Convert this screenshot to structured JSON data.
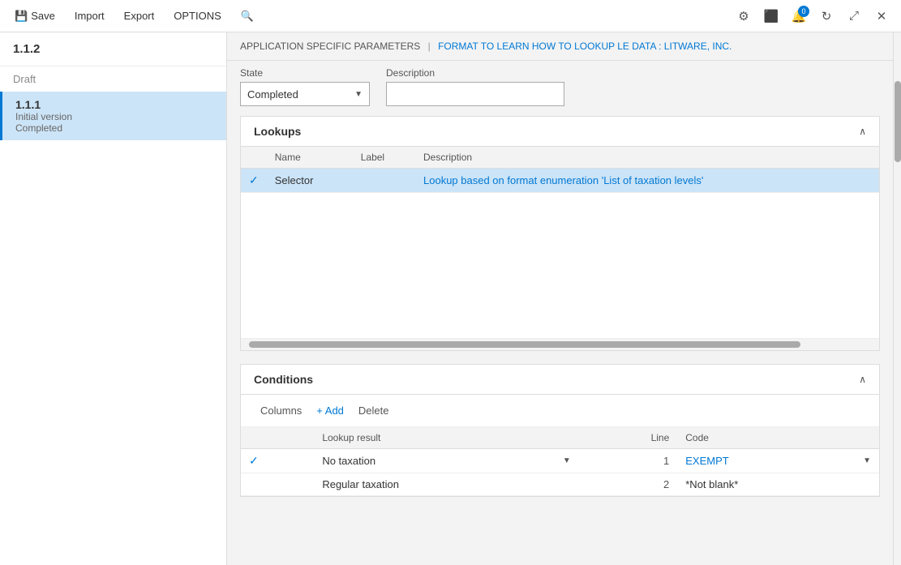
{
  "titlebar": {
    "save_label": "Save",
    "import_label": "Import",
    "export_label": "Export",
    "options_label": "OPTIONS",
    "notification_count": "0",
    "save_icon": "💾"
  },
  "sidebar": {
    "version_label": "1.1.2",
    "draft_label": "Draft",
    "item": {
      "version": "1.1.1",
      "subtitle": "Initial version",
      "status": "Completed"
    }
  },
  "breadcrumb": {
    "part1": "APPLICATION SPECIFIC PARAMETERS",
    "separator": "|",
    "part2": "FORMAT TO LEARN HOW TO LOOKUP LE DATA : LITWARE, INC."
  },
  "params": {
    "state_label": "State",
    "state_value": "Completed",
    "description_label": "Description",
    "description_placeholder": ""
  },
  "lookups": {
    "section_title": "Lookups",
    "columns": {
      "check": "",
      "name": "Name",
      "label": "Label",
      "description": "Description"
    },
    "rows": [
      {
        "checked": true,
        "name": "Selector",
        "label": "",
        "description": "Lookup based on format enumeration 'List of taxation levels'"
      }
    ]
  },
  "conditions": {
    "section_title": "Conditions",
    "toolbar": {
      "columns_label": "Columns",
      "add_label": "+ Add",
      "delete_label": "Delete"
    },
    "columns": {
      "check": "",
      "lookup_result": "Lookup result",
      "line": "Line",
      "code": "Code"
    },
    "rows": [
      {
        "checked": true,
        "lookup_result": "No taxation",
        "line": "1",
        "code": "EXEMPT"
      },
      {
        "checked": false,
        "lookup_result": "Regular taxation",
        "line": "2",
        "code": "*Not blank*"
      }
    ]
  }
}
